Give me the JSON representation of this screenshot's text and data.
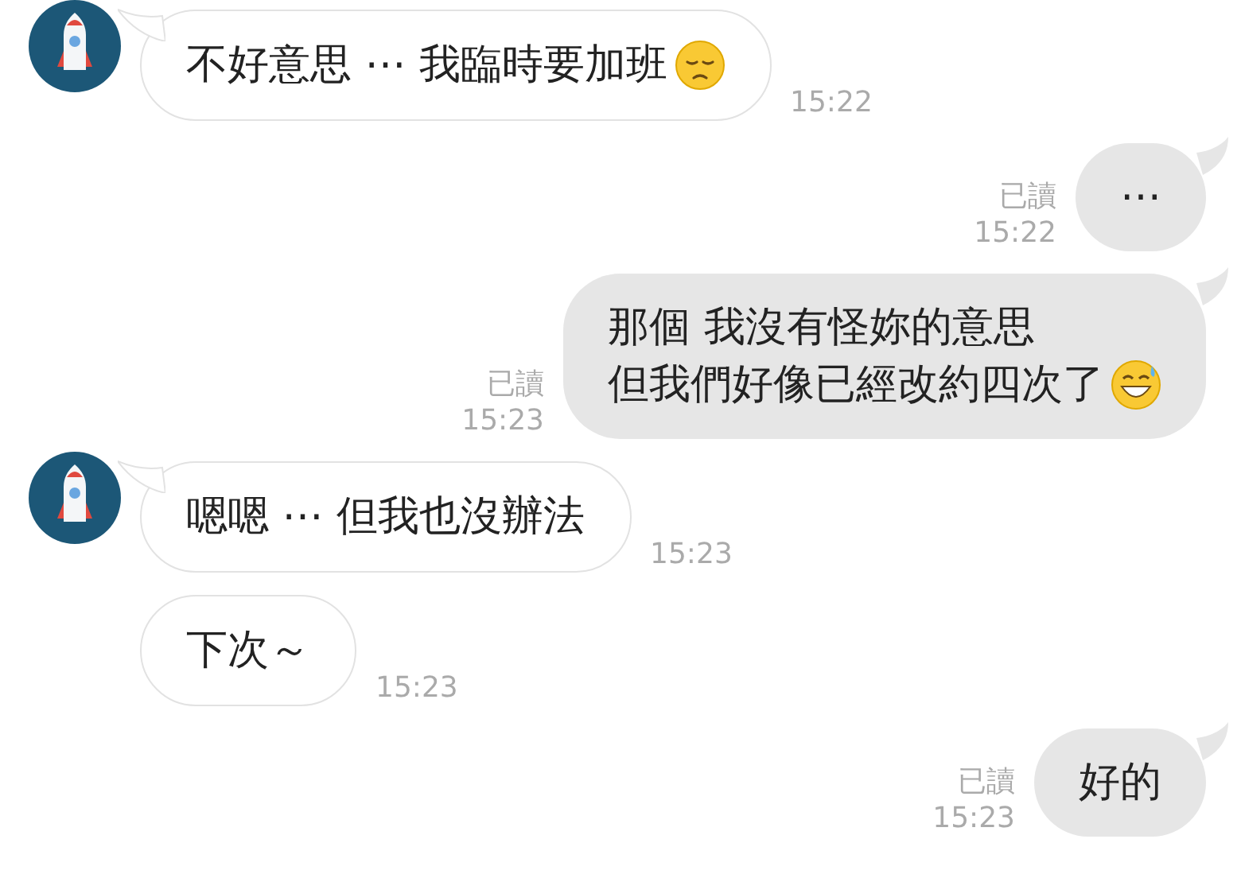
{
  "messages": [
    {
      "kind": "incoming",
      "avatar": true,
      "lines": [
        "不好意思 ⋯ 我臨時要加班"
      ],
      "emoji": {
        "kind": "pensive"
      },
      "time": "15:22"
    },
    {
      "kind": "outgoing",
      "lines": [
        "⋯"
      ],
      "read": "已讀",
      "time": "15:22"
    },
    {
      "kind": "outgoing",
      "lines": [
        "那個 我沒有怪妳的意思",
        "但我們好像已經改約四次了"
      ],
      "emoji": {
        "kind": "sweat_smile"
      },
      "read": "已讀",
      "time": "15:23"
    },
    {
      "kind": "incoming",
      "avatar": true,
      "lines": [
        "嗯嗯 ⋯ 但我也沒辦法"
      ],
      "time": "15:23"
    },
    {
      "kind": "incoming",
      "avatar": false,
      "lines": [
        "下次～"
      ],
      "time": "15:23"
    },
    {
      "kind": "outgoing",
      "lines": [
        "好的"
      ],
      "read": "已讀",
      "time": "15:23"
    }
  ]
}
